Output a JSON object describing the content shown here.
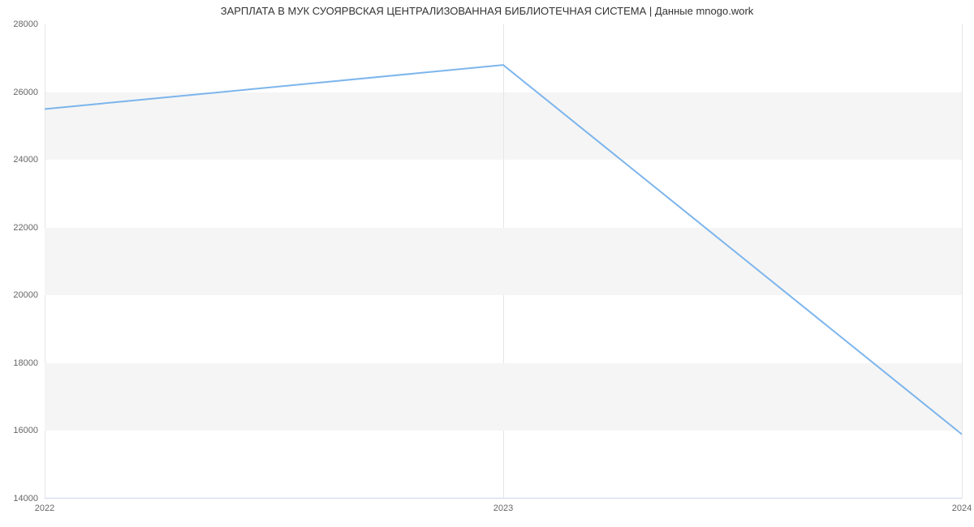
{
  "chart_data": {
    "type": "line",
    "title": "ЗАРПЛАТА В МУК СУОЯРВСКАЯ ЦЕНТРАЛИЗОВАННАЯ БИБЛИОТЕЧНАЯ СИСТЕМА | Данные mnogo.work",
    "x": [
      2022,
      2023,
      2024
    ],
    "values": [
      25500,
      26800,
      15900
    ],
    "x_ticks": [
      2022,
      2023,
      2024
    ],
    "y_ticks": [
      14000,
      16000,
      18000,
      20000,
      22000,
      24000,
      26000,
      28000
    ],
    "xlim": [
      2022,
      2024
    ],
    "ylim": [
      14000,
      28000
    ],
    "line_color": "#7cb5ec"
  }
}
